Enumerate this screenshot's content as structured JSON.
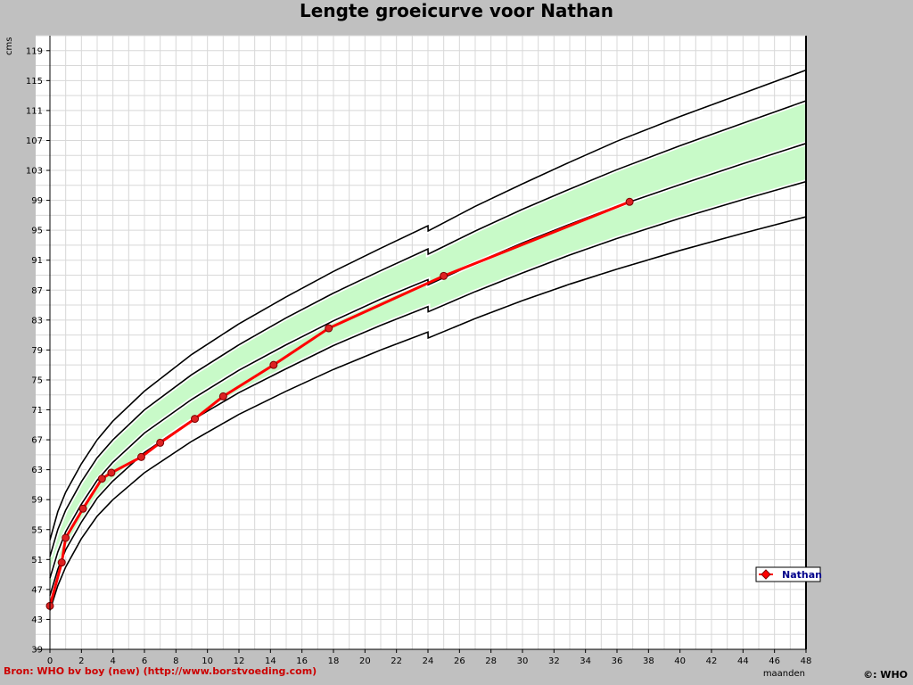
{
  "chart_data": {
    "type": "line",
    "title": "Lengte groeicurve voor Nathan",
    "xlabel": "maanden",
    "ylabel": "cms",
    "xlim": [
      0,
      48
    ],
    "ylim": [
      39,
      121
    ],
    "x_ticks": [
      0,
      2,
      4,
      6,
      8,
      10,
      12,
      14,
      16,
      18,
      20,
      22,
      24,
      26,
      28,
      30,
      32,
      34,
      36,
      38,
      40,
      42,
      44,
      46,
      48
    ],
    "y_ticks": [
      39,
      43,
      47,
      51,
      55,
      59,
      63,
      67,
      71,
      75,
      79,
      83,
      87,
      91,
      95,
      99,
      103,
      107,
      111,
      115,
      119
    ],
    "grid": true,
    "legend": "bottom-right",
    "colors": {
      "background": "#c0c0c0",
      "plot": "#ffffff",
      "grid": "#d8d8d8",
      "band": "#c8fac8",
      "reference": "#000000",
      "series": "#ff0000",
      "marker": "#dd2222"
    },
    "reference_curves": [
      {
        "x": [
          0,
          0.5,
          1,
          2,
          3,
          4,
          6,
          9,
          12,
          15,
          18,
          21,
          24,
          24.01,
          27,
          30,
          33,
          36,
          40,
          44,
          48
        ],
        "y": [
          44.2,
          47.5,
          50.0,
          53.8,
          56.8,
          59.0,
          62.6,
          66.8,
          70.4,
          73.5,
          76.4,
          79.0,
          81.4,
          80.6,
          83.2,
          85.6,
          87.8,
          89.8,
          92.3,
          94.6,
          96.8
        ]
      },
      {
        "x": [
          0,
          0.5,
          1,
          2,
          3,
          4,
          6,
          9,
          12,
          15,
          18,
          21,
          24,
          24.01,
          27,
          30,
          33,
          36,
          40,
          44,
          48
        ],
        "y": [
          46.2,
          49.7,
          52.3,
          56.0,
          59.2,
          61.5,
          65.3,
          69.6,
          73.3,
          76.5,
          79.6,
          82.3,
          84.8,
          84.1,
          86.8,
          89.3,
          91.7,
          93.9,
          96.6,
          99.1,
          101.5
        ]
      },
      {
        "x": [
          0,
          0.5,
          1,
          2,
          3,
          4,
          6,
          9,
          12,
          15,
          18,
          21,
          24,
          24.01,
          27,
          30,
          33,
          36,
          40,
          44,
          48
        ],
        "y": [
          48.5,
          52.0,
          54.7,
          58.4,
          61.6,
          64.0,
          67.9,
          72.4,
          76.3,
          79.7,
          82.9,
          85.8,
          88.4,
          87.7,
          90.6,
          93.3,
          95.8,
          98.2,
          101.1,
          103.9,
          106.6
        ]
      },
      {
        "x": [
          0,
          0.5,
          1,
          2,
          3,
          4,
          6,
          9,
          12,
          15,
          18,
          21,
          24,
          24.01,
          27,
          30,
          33,
          36,
          40,
          44,
          48
        ],
        "y": [
          51.4,
          55.0,
          57.6,
          61.4,
          64.6,
          67.0,
          71.0,
          75.7,
          79.7,
          83.3,
          86.6,
          89.6,
          92.5,
          91.8,
          94.9,
          97.8,
          100.5,
          103.1,
          106.3,
          109.3,
          112.3
        ]
      },
      {
        "x": [
          0,
          0.5,
          1,
          2,
          3,
          4,
          6,
          9,
          12,
          15,
          18,
          21,
          24,
          24.01,
          27,
          30,
          33,
          36,
          40,
          44,
          48
        ],
        "y": [
          53.6,
          57.4,
          60.0,
          63.8,
          67.0,
          69.5,
          73.5,
          78.4,
          82.5,
          86.1,
          89.5,
          92.6,
          95.6,
          94.9,
          98.2,
          101.2,
          104.1,
          106.9,
          110.2,
          113.3,
          116.4
        ]
      }
    ],
    "band": {
      "lower_curve": 1,
      "upper_curve": 3
    },
    "series": [
      {
        "name": "Nathan",
        "x": [
          0,
          0.75,
          1,
          2.1,
          3.3,
          3.9,
          5.8,
          7.0,
          9.2,
          11.0,
          14.2,
          17.7,
          25.0,
          36.8
        ],
        "y": [
          44.8,
          50.6,
          53.9,
          57.8,
          61.8,
          62.6,
          64.7,
          66.6,
          69.8,
          72.8,
          77.0,
          81.9,
          88.9,
          98.8
        ]
      }
    ]
  },
  "footer": {
    "source": "Bron: WHO bv boy (new) (http://www.borstvoeding.com)",
    "copyright": "©: WHO"
  }
}
